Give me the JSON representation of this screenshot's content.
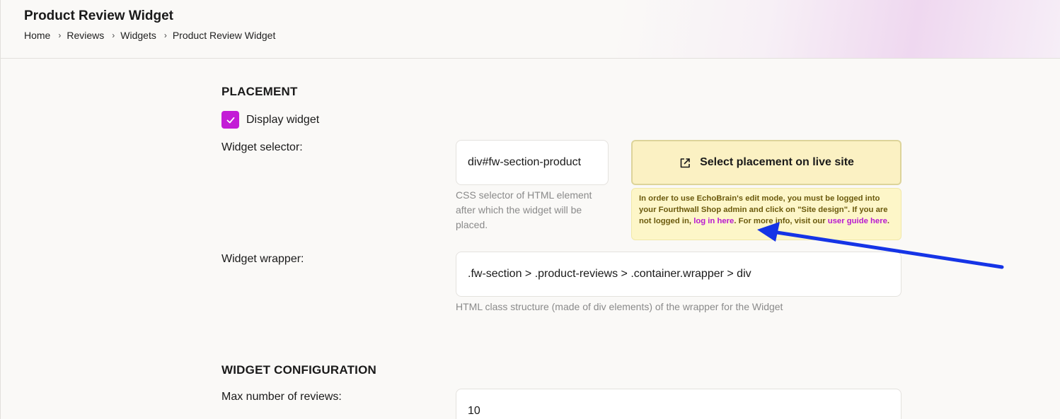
{
  "header": {
    "title": "Product Review Widget",
    "breadcrumb": [
      "Home",
      "Reviews",
      "Widgets",
      "Product Review Widget"
    ],
    "separator": "›"
  },
  "placement": {
    "section_title": "PLACEMENT",
    "display_widget": {
      "label": "Display widget",
      "checked": true
    },
    "widget_selector": {
      "label": "Widget selector:",
      "value": "div#fw-section-product",
      "helper": "CSS selector of HTML element after which the widget will be placed."
    },
    "live_button": {
      "label": "Select placement on live site",
      "icon": "external-link-icon"
    },
    "notice": {
      "text_1": "In order to use EchoBrain's edit mode, you must be logged into your Fourthwall Shop admin and click on \"Site design\". If you are not logged in, ",
      "link_login": "log in here",
      "text_2": ". For more info, visit our ",
      "link_guide": "user guide here",
      "text_3": "."
    },
    "widget_wrapper": {
      "label": "Widget wrapper:",
      "value": ".fw-section > .product-reviews > .container.wrapper > div",
      "helper": "HTML class structure (made of div elements) of the wrapper for the Widget"
    }
  },
  "configuration": {
    "section_title": "WIDGET CONFIGURATION",
    "max_reviews": {
      "label": "Max number of reviews:",
      "value": "10"
    }
  },
  "colors": {
    "accent": "#c31cd6",
    "button_bg": "#fbf1c3",
    "notice_bg": "#fdf6c8",
    "annotation_arrow": "#1534e6"
  }
}
